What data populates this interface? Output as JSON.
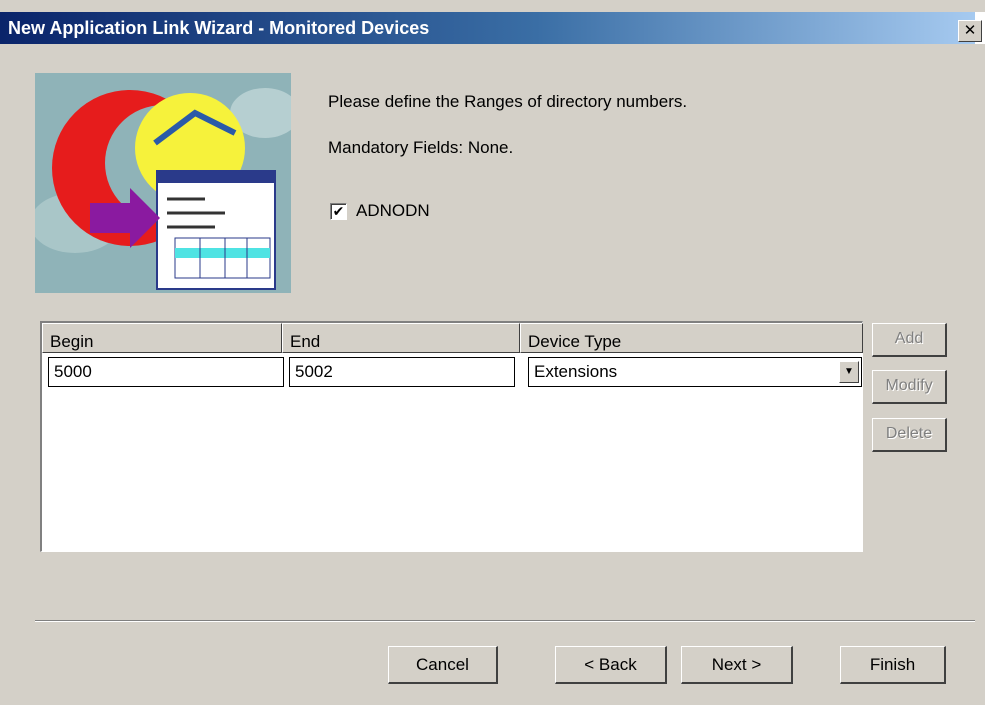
{
  "window": {
    "title": "New Application Link Wizard - Monitored Devices",
    "close_label": "✕"
  },
  "header": {
    "instruction": "Please define the Ranges of directory numbers.",
    "mandatory": "Mandatory Fields: None.",
    "checkbox_label": "ADNODN",
    "checkbox_checked": true
  },
  "grid": {
    "columns": [
      "Begin",
      "End",
      "Device Type"
    ],
    "row": {
      "begin": "5000",
      "end": "5002",
      "device_type": "Extensions"
    }
  },
  "side_buttons": {
    "add": "Add",
    "modify": "Modify",
    "delete": "Delete"
  },
  "footer": {
    "cancel": "Cancel",
    "back": "< Back",
    "next": "Next >",
    "finish": "Finish"
  },
  "colors": {
    "dialog_bg": "#d4d0c8",
    "title_start": "#0a246a",
    "title_end": "#a6caf0"
  }
}
